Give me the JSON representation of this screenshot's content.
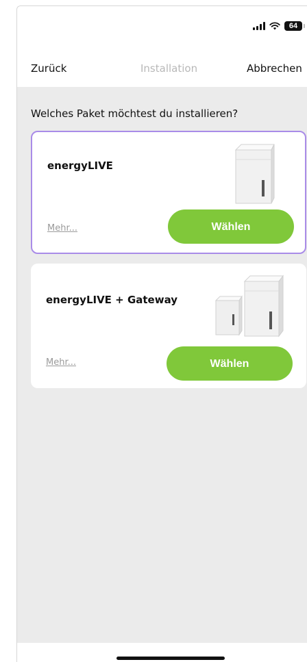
{
  "status_bar": {
    "battery": "64"
  },
  "nav": {
    "back_label": "Zurück",
    "title": "Installation",
    "cancel_label": "Abbrechen"
  },
  "question": "Welches Paket möchtest du installieren?",
  "packages": [
    {
      "name": "energyLIVE",
      "more_label": "Mehr...",
      "choose_label": "Wählen",
      "selected": true
    },
    {
      "name": "energyLIVE + Gateway",
      "more_label": "Mehr...",
      "choose_label": "Wählen",
      "selected": false
    }
  ],
  "colors": {
    "accent_green": "#80c83a",
    "selected_border": "#a98be8",
    "background": "#ebebeb"
  }
}
